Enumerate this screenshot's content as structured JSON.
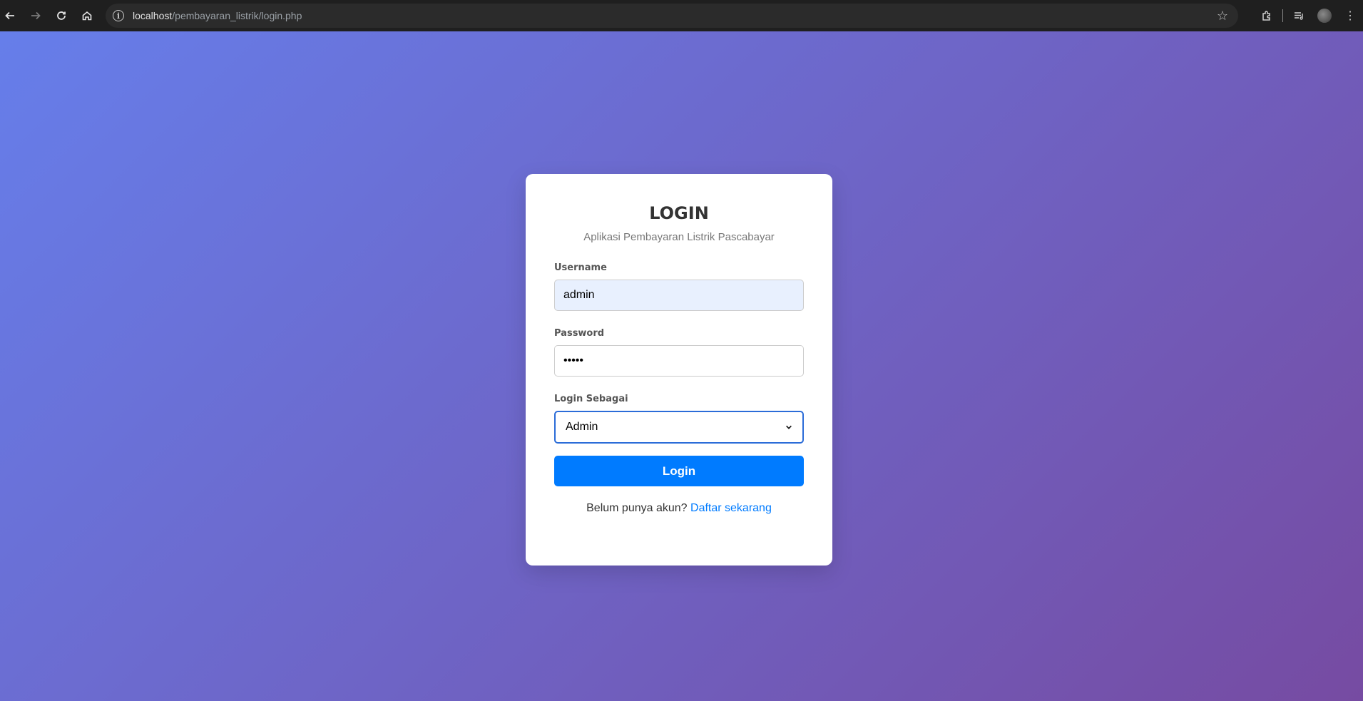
{
  "browser": {
    "url_host": "localhost",
    "url_path": "/pembayaran_listrik/login.php",
    "back_icon": "back-arrow-icon",
    "forward_icon": "forward-arrow-icon",
    "reload_icon": "reload-icon",
    "home_icon": "home-icon"
  },
  "login": {
    "title": "LOGIN",
    "subtitle": "Aplikasi Pembayaran Listrik Pascabayar",
    "username_label": "Username",
    "username_value": "admin",
    "password_label": "Password",
    "password_value": "•••••",
    "role_label": "Login Sebagai",
    "role_value": "Admin",
    "submit_label": "Login",
    "register_prompt": "Belum punya akun?",
    "register_link": "Daftar sekarang"
  },
  "colors": {
    "gradient_start": "#667eea",
    "gradient_end": "#764ba2",
    "primary": "#007bff"
  }
}
